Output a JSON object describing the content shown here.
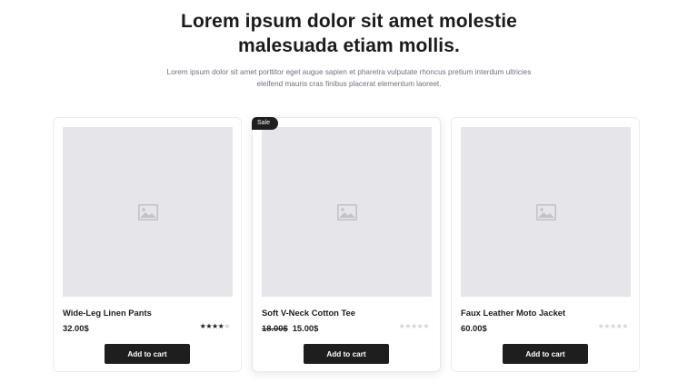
{
  "header": {
    "title_line1": "Lorem ipsum dolor sit amet molestie",
    "title_line2": "malesuada etiam mollis.",
    "description": "Lorem ipsum dolor sit amet porttitor eget augue sapien et pharetra vulputate rhoncus pretium interdum ultricies eleifend mauris cras finibus placerat elementum laoreet."
  },
  "products": [
    {
      "name": "Wide-Leg Linen Pants",
      "price": "32.00$",
      "rating": 4,
      "rating_max": 5,
      "button_label": "Add to cart",
      "image_icon": "image-placeholder-icon"
    },
    {
      "badge": "Sale",
      "name": "Soft V-Neck Cotton Tee",
      "old_price": "18.00$",
      "price": "15.00$",
      "rating": 0,
      "rating_max": 5,
      "button_label": "Add to cart",
      "image_icon": "image-placeholder-icon"
    },
    {
      "name": "Faux Leather Moto Jacket",
      "price": "60.00$",
      "rating": 0,
      "rating_max": 5,
      "button_label": "Add to cart",
      "image_icon": "image-placeholder-icon"
    }
  ],
  "colors": {
    "button_bg": "#1e1e1e",
    "image_placeholder": "#e6e6ea",
    "star_filled": "#1d1d1d",
    "star_empty": "#d4d4d8"
  }
}
